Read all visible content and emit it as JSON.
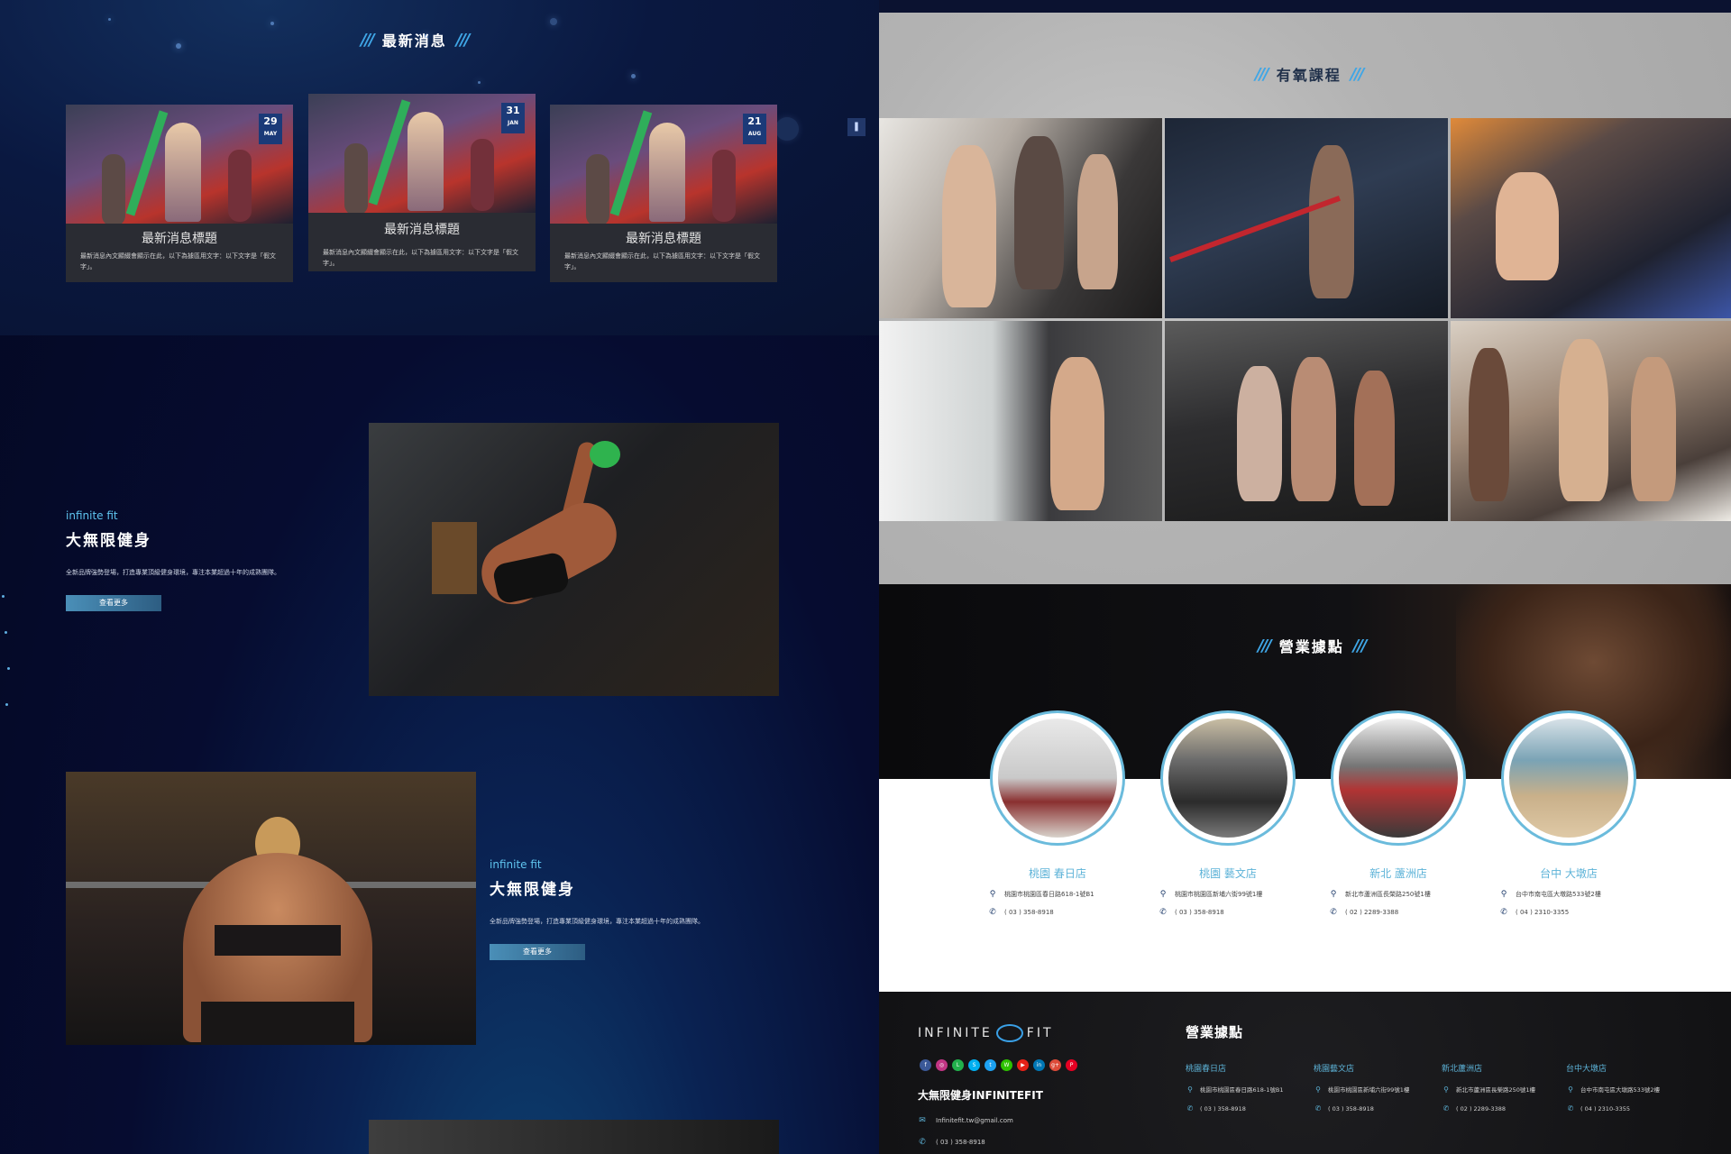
{
  "news": {
    "title": "最新消息",
    "slashes": "///",
    "next_arrow": "❚",
    "cards": [
      {
        "day": "29",
        "month": "MAY",
        "title": "最新消息標題",
        "text": "最新消息內文顯綴會顯示在此，以下為據區用文字：以下文字是「假文字」。"
      },
      {
        "day": "31",
        "month": "JAN",
        "title": "最新消息標題",
        "text": "最新消息內文顯綴會顯示在此，以下為據區用文字：以下文字是「假文字」。"
      },
      {
        "day": "21",
        "month": "AUG",
        "title": "最新消息標題",
        "text": "最新消息內文顯綴會顯示在此，以下為據區用文字：以下文字是「假文字」。"
      }
    ]
  },
  "about": [
    {
      "sub": "infinite fit",
      "heading": "大無限健身",
      "text": "全新品牌強勢登場，打造專業頂級健身環境，專注本業超過十年的成熟團隊。",
      "button": "查看更多"
    },
    {
      "sub": "infinite fit",
      "heading": "大無限健身",
      "text": "全新品牌強勢登場，打造專業頂級健身環境，專注本業超過十年的成熟團隊。",
      "button": "查看更多"
    }
  ],
  "aerobic": {
    "title": "有氧課程"
  },
  "stores": {
    "title": "營業據點",
    "items": [
      {
        "name": "桃園 春日店",
        "address": "桃園市桃園區春日路618-1號B1",
        "phone": "( 03 ) 358-8918"
      },
      {
        "name": "桃園 藝文店",
        "address": "桃園市桃園區新埔六街99號1樓",
        "phone": "( 03 ) 358-8918"
      },
      {
        "name": "新北 蘆洲店",
        "address": "新北市蘆洲區長榮路250號1樓",
        "phone": "( 02 ) 2289-3388"
      },
      {
        "name": "台中 大墩店",
        "address": "台中市南屯區大墩路533號2樓",
        "phone": "( 04 ) 2310-3355"
      }
    ]
  },
  "footer": {
    "logo_left": "INFINITE",
    "logo_right": "FIT",
    "brand": "大無限健身INFINITEFIT",
    "email": "Infinitefit.tw@gmail.com",
    "phone": "( 03 ) 358-8918",
    "stores_title": "營業據點",
    "stores": [
      {
        "name": "桃園春日店",
        "address": "桃園市桃園區春日路618-1號B1",
        "phone": "( 03 ) 358-8918"
      },
      {
        "name": "桃園藝文店",
        "address": "桃園市桃園區新埔六街99號1樓",
        "phone": "( 03 ) 358-8918"
      },
      {
        "name": "新北蘆洲店",
        "address": "新北市蘆洲區長榮路250號1樓",
        "phone": "( 02 ) 2289-3388"
      },
      {
        "name": "台中大墩店",
        "address": "台中市南屯區大墩路533號2樓",
        "phone": "( 04 ) 2310-3355"
      }
    ],
    "socials": [
      "facebook-icon",
      "instagram-icon",
      "line-icon",
      "skype-icon",
      "twitter-icon",
      "wechat-icon",
      "youtube-icon",
      "linkedin-icon",
      "google-plus-icon",
      "pinterest-icon"
    ],
    "social_glyphs": [
      "f",
      "◎",
      "L",
      "S",
      "t",
      "W",
      "▶",
      "in",
      "g+",
      "P"
    ],
    "social_colors": [
      "#3b5998",
      "#c13584",
      "#22b14c",
      "#00aff0",
      "#1da1f2",
      "#2dc100",
      "#e62117",
      "#0077b5",
      "#dd4b39",
      "#e60023"
    ]
  }
}
